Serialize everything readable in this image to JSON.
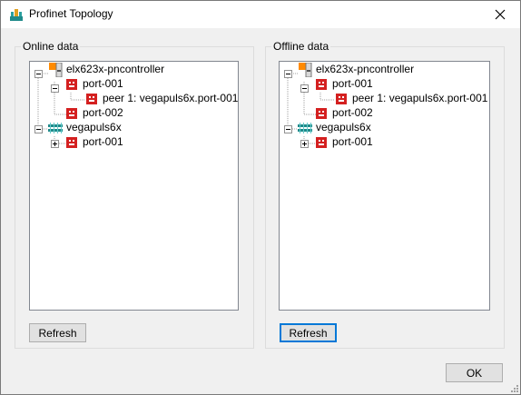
{
  "window": {
    "title": "Profinet Topology"
  },
  "online": {
    "label": "Online data",
    "tree": {
      "controller": "elx623x-pncontroller",
      "port1": "port-001",
      "peer": "peer 1: vegapuls6x.port-001",
      "port2": "port-002",
      "device": "vegapuls6x",
      "device_port": "port-001"
    },
    "refresh_label": "Refresh"
  },
  "offline": {
    "label": "Offline data",
    "tree": {
      "controller": "elx623x-pncontroller",
      "port1": "port-001",
      "peer": "peer 1: vegapuls6x.port-001",
      "port2": "port-002",
      "device": "vegapuls6x",
      "device_port": "port-001"
    },
    "refresh_label": "Refresh"
  },
  "ok_label": "OK",
  "colors": {
    "port_icon": "#d42020",
    "controller_icon": "#ff8a00",
    "device_icon": "#1f8a8a",
    "focus_border": "#0078d7"
  }
}
